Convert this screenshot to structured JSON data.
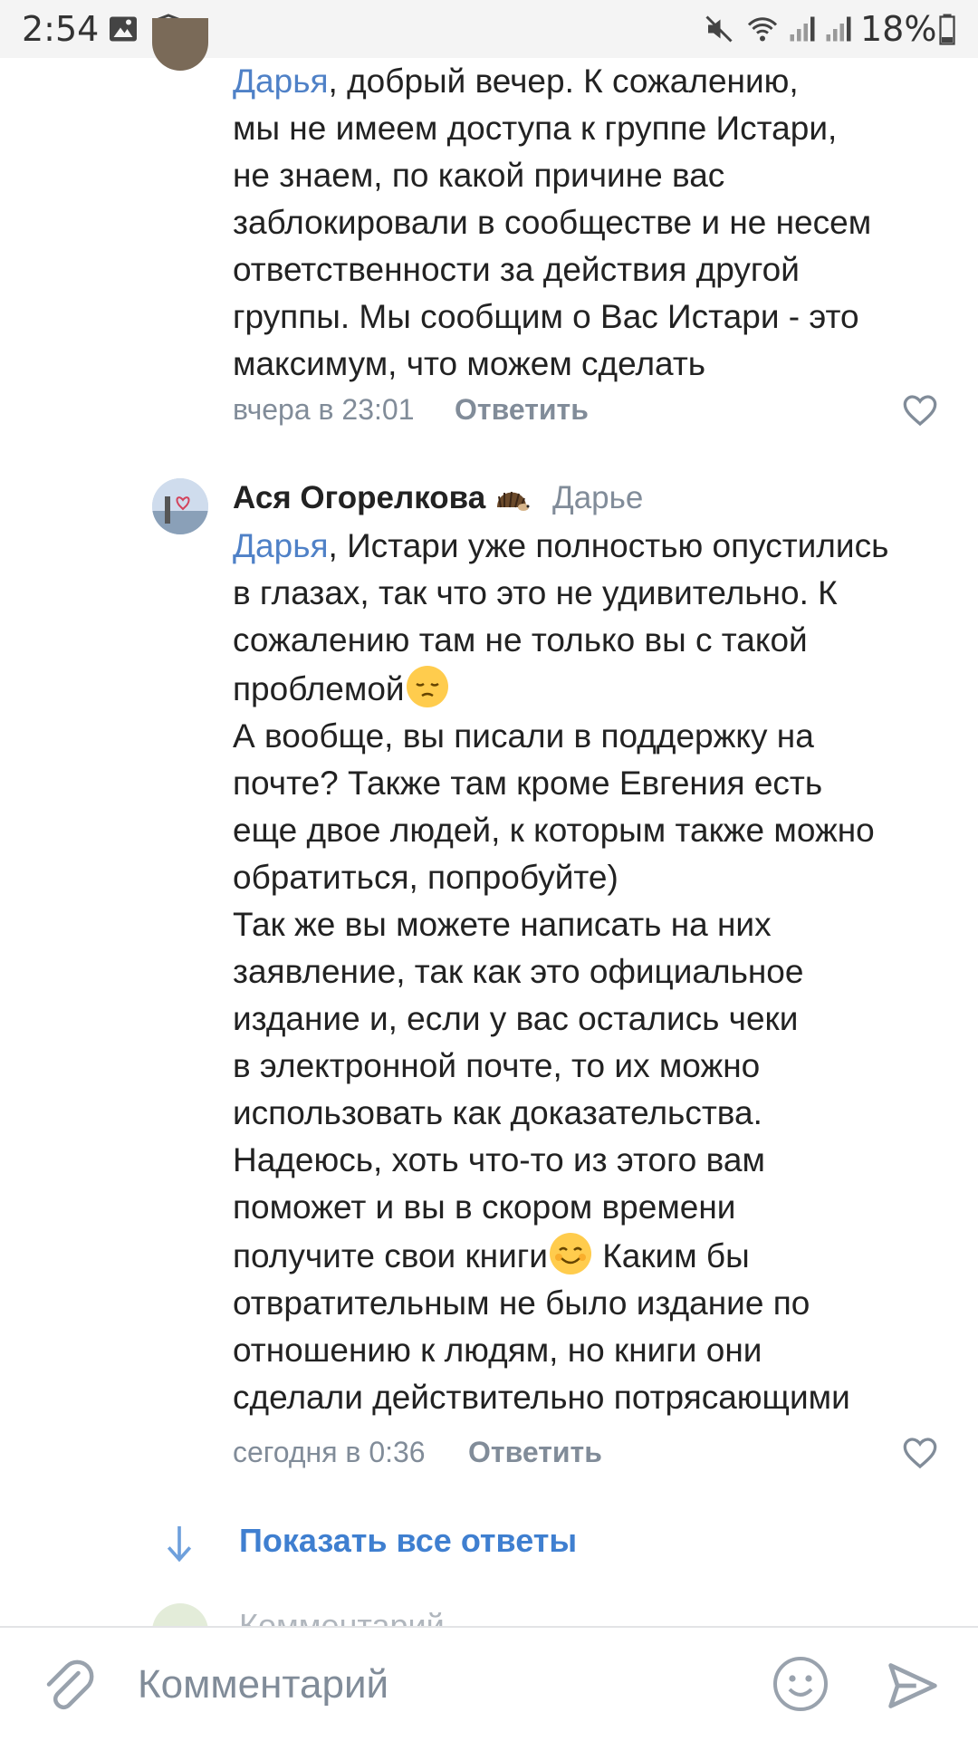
{
  "status_bar": {
    "time": "2:54",
    "battery_percent": "18%",
    "icons": [
      "image-icon",
      "shield-icon",
      "mute-icon",
      "wifi-icon",
      "signal-icon",
      "signal-icon",
      "battery-icon"
    ]
  },
  "comments": [
    {
      "mention": "Дарья",
      "text": ", добрый вечер. К сожалению,\nмы не имеем доступа к группе Истари,\nне знаем, по какой причине вас\nзаблокировали в сообществе и не несем\nответственности за действия другой\nгруппы. Мы сообщим о Вас Истари - это\nмаксимум, что можем сделать",
      "time": "вчера в 23:01",
      "reply_label": "Ответить"
    },
    {
      "author": "Ася Огорелкова",
      "reply_to": "Дарье",
      "mention": "Дарья",
      "text_part1": ", Истари уже полностью опустились\nв глазах, так что это не удивительно. К\nсожалению там не только вы с такой\nпроблемой",
      "text_part2": "\nА вообще, вы писали в поддержку на\nпочте? Также там кроме Евгения есть\nеще двое людей, к которым также можно\nобратиться, попробуйте)\nТак же вы можете написать на них\nзаявление, так как это официальное\nиздание и, если у вас остались чеки\nв электронной почте, то их можно\nиспользовать как доказательства.\nНадеюсь, хоть что-то из этого вам\nпоможет и вы в скором времени\nполучите свои книги",
      "text_part3": " Каким бы\nотвратительным не было издание по\nотношению к людям, но книги они\nсделали действительно потрясающими",
      "time": "сегодня в 0:36",
      "reply_label": "Ответить"
    }
  ],
  "show_all_replies": "Показать все ответы",
  "peek_comment_text": "Комментарий",
  "composer": {
    "placeholder": "Комментарий"
  },
  "colors": {
    "accent": "#4f81c7",
    "muted": "#818c99"
  }
}
